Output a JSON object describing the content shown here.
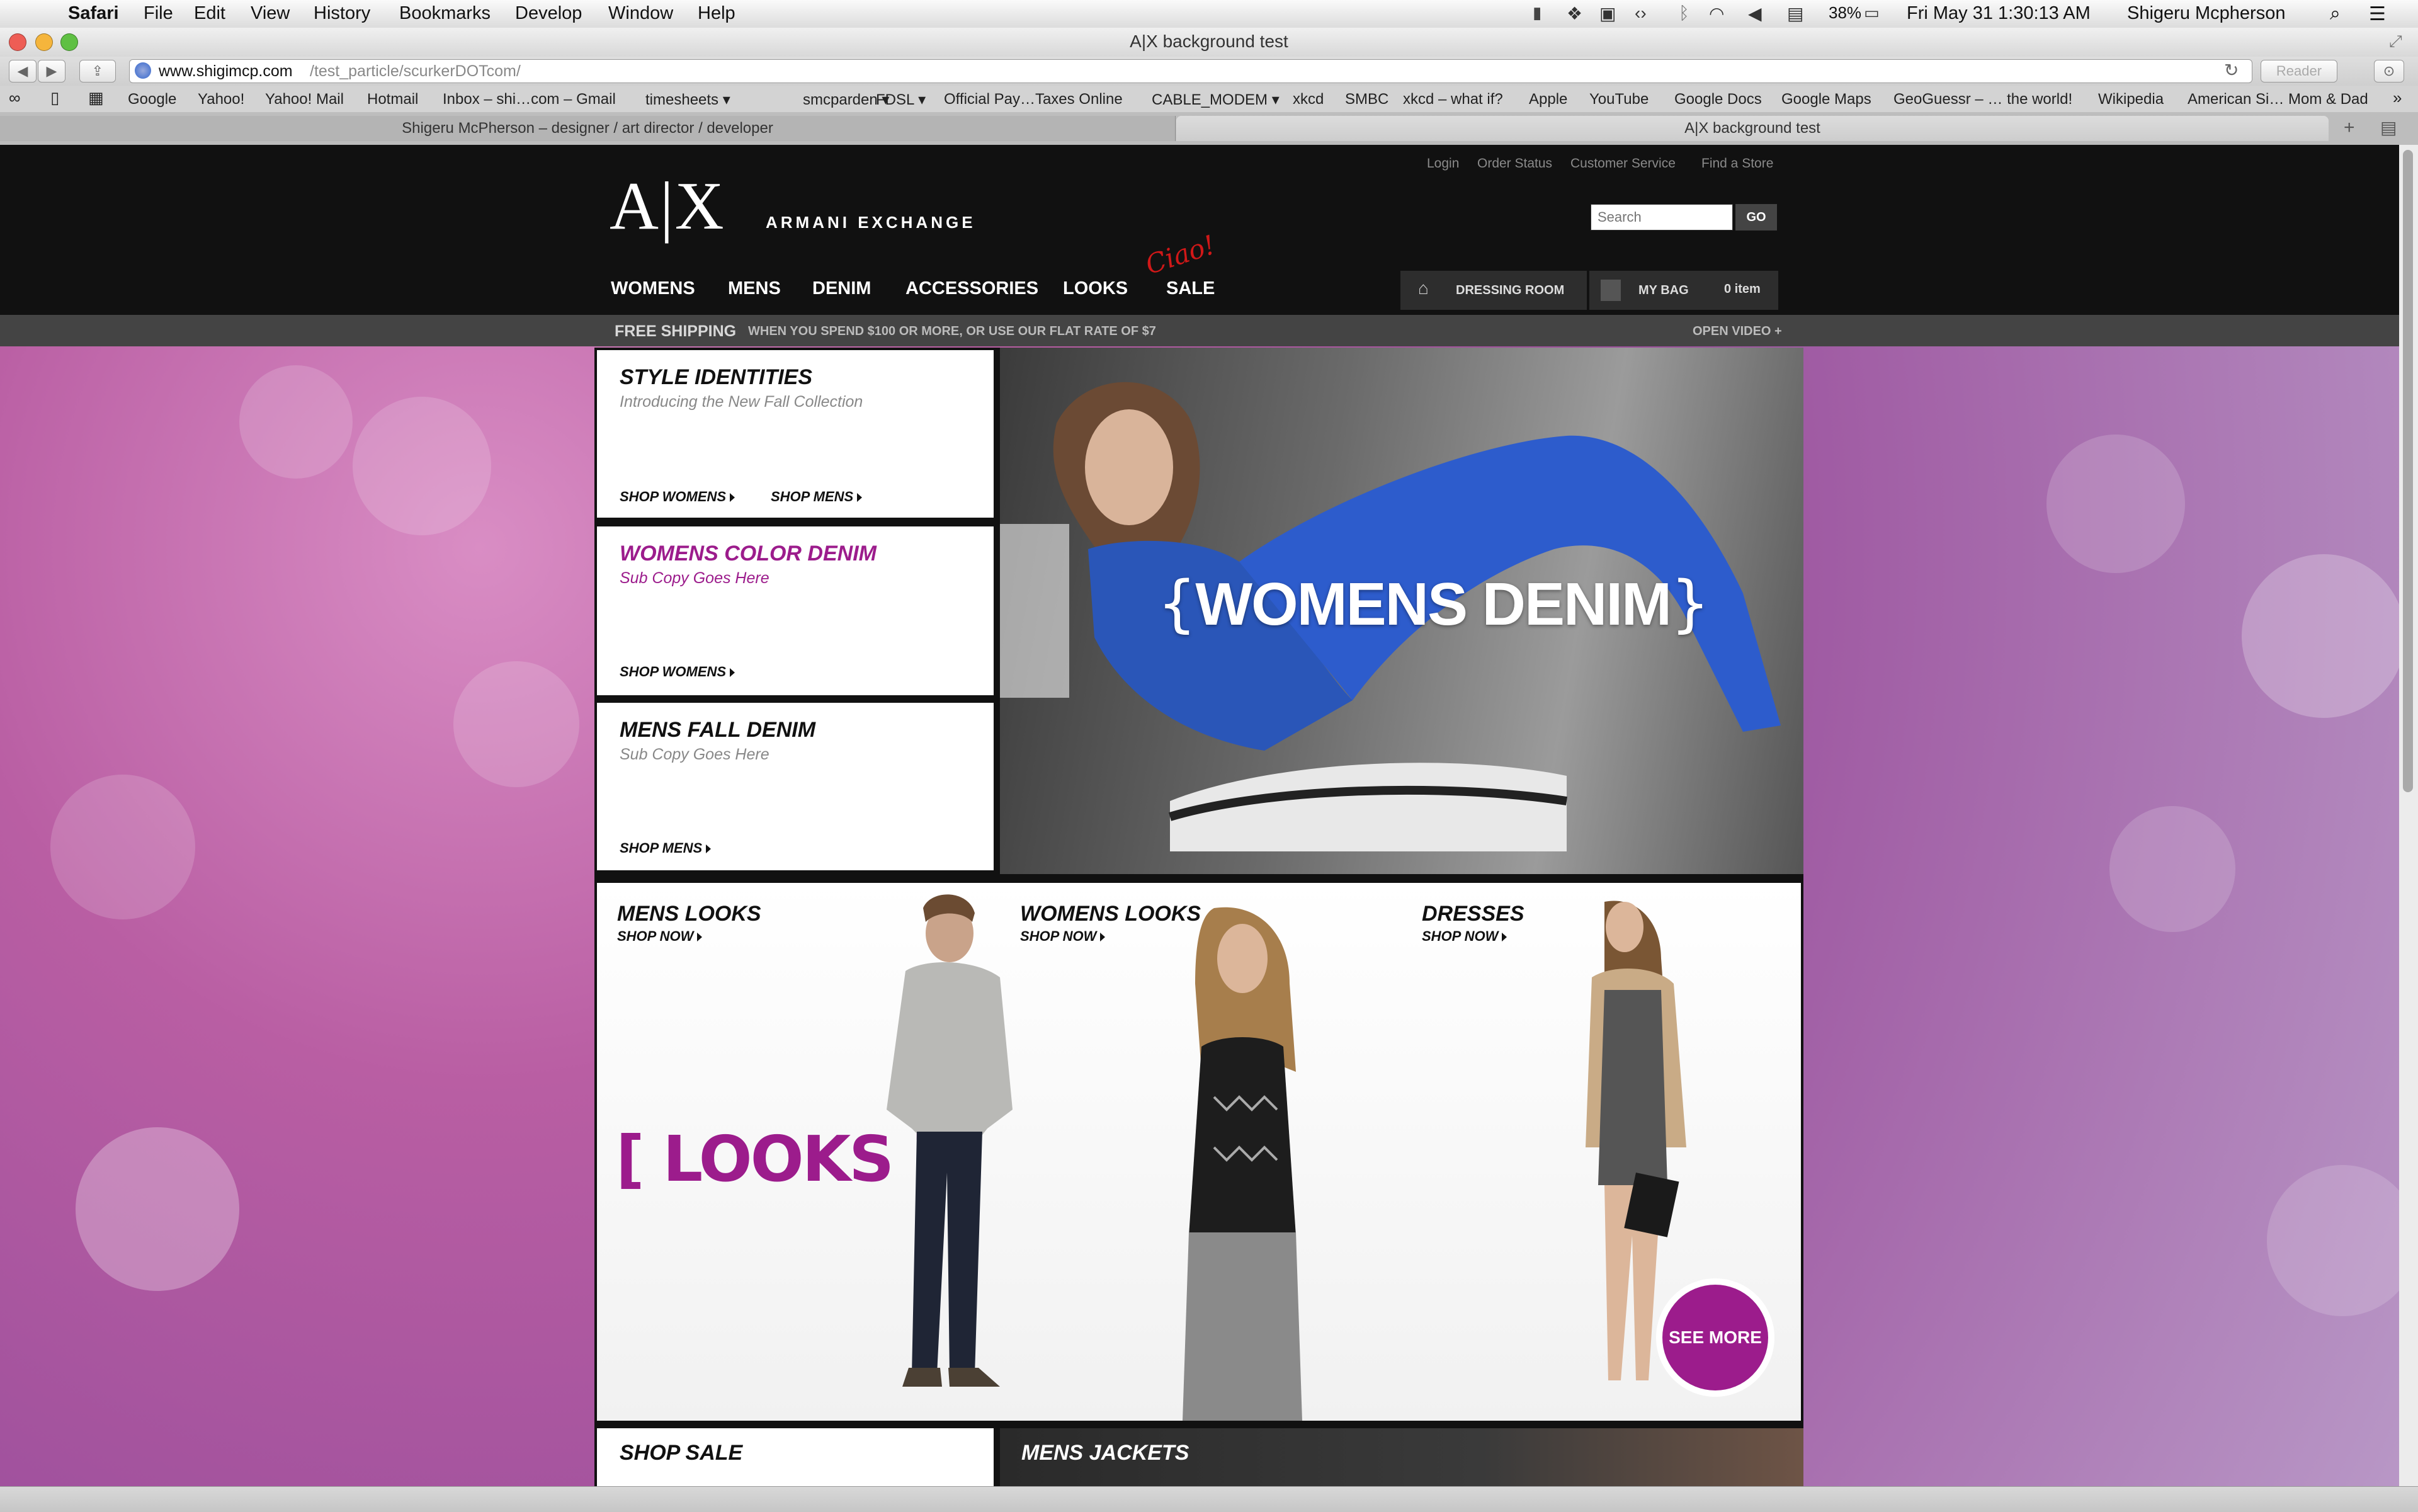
{
  "menubar": {
    "app": "Safari",
    "items": [
      "File",
      "Edit",
      "View",
      "History",
      "Bookmarks",
      "Develop",
      "Window",
      "Help"
    ],
    "battery": "38%",
    "clock": "Fri May 31  1:30:13 AM",
    "user": "Shigeru Mcpherson"
  },
  "window": {
    "title": "A|X background test"
  },
  "toolbar": {
    "url_host": "www.shigimcp.com",
    "url_path": "/test_particle/scurkerDOTcom/",
    "reader_label": "Reader"
  },
  "bookmarks": [
    "Google",
    "Yahoo!",
    "Yahoo! Mail",
    "Hotmail",
    "Inbox – shi…com – Gmail",
    "timesheets ▾",
    "smcparden ▾",
    "FDSL ▾",
    "Official Pay…Taxes Online",
    "CABLE_MODEM ▾",
    "xkcd",
    "SMBC",
    "xkcd – what if?",
    "Apple",
    "YouTube",
    "Google Docs",
    "Google Maps",
    "GeoGuessr – … the world!",
    "Wikipedia",
    "American Si… Mom & Dad"
  ],
  "tabs": [
    "Shigeru McPherson – designer / art director / developer",
    "A|X background test"
  ],
  "site": {
    "logo": "A|X",
    "brand": "ARMANI EXCHANGE",
    "utility_links": [
      "Login",
      "Order Status",
      "Customer Service",
      "Find a Store"
    ],
    "search_placeholder": "Search",
    "go_label": "GO",
    "nav": [
      "WOMENS",
      "MENS",
      "DENIM",
      "ACCESSORIES",
      "LOOKS",
      "SALE"
    ],
    "ciao": "Ciao!",
    "dressing_room": "DRESSING ROOM",
    "my_bag": "MY BAG",
    "bag_count": "0 item",
    "promo_bold": "FREE SHIPPING",
    "promo_text": "WHEN YOU SPEND $100 OR MORE, OR USE OUR FLAT RATE OF $7",
    "open_video": "OPEN VIDEO +",
    "accent": "#9c1c8c"
  },
  "panels": {
    "style_identities": {
      "title": "STYLE IDENTITIES",
      "sub": "Introducing the New Fall Collection",
      "link1": "SHOP WOMENS",
      "link2": "SHOP MENS"
    },
    "womens_color_denim": {
      "title": "WOMENS COLOR DENIM",
      "sub": "Sub Copy Goes Here",
      "link": "SHOP WOMENS"
    },
    "mens_fall_denim": {
      "title": "MENS FALL DENIM",
      "sub": "Sub Copy Goes Here",
      "link": "SHOP MENS"
    },
    "hero": {
      "text": "WOMENS DENIM",
      "brace_open": "{",
      "brace_close": "}"
    },
    "looks": {
      "label": "[ LOOKS ]",
      "mens": {
        "title": "MENS LOOKS",
        "link": "SHOP NOW"
      },
      "womens": {
        "title": "WOMENS LOOKS",
        "link": "SHOP NOW"
      },
      "dresses": {
        "title": "DRESSES",
        "link": "SHOP NOW"
      },
      "see_more": "SEE MORE"
    },
    "shop_sale": {
      "title": "SHOP SALE"
    },
    "mens_jackets": {
      "title": "MENS JACKETS"
    }
  }
}
